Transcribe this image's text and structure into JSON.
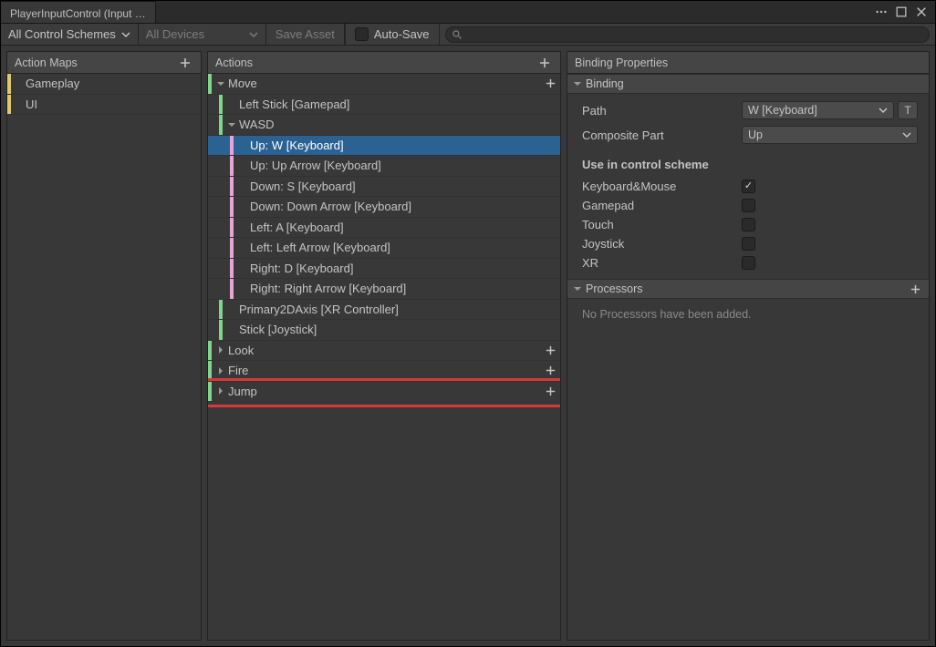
{
  "tab": {
    "title": "PlayerInputControl (Input …"
  },
  "toolbar": {
    "scheme_label": "All Control Schemes",
    "devices_label": "All Devices",
    "save_label": "Save Asset",
    "autosave_label": "Auto-Save",
    "autosave_checked": false
  },
  "columns": {
    "maps_title": "Action Maps",
    "actions_title": "Actions",
    "props_title": "Binding Properties"
  },
  "maps": [
    {
      "label": "Gameplay"
    },
    {
      "label": "UI"
    }
  ],
  "actions": [
    {
      "kind": "action",
      "label": "Move",
      "stripe": "green",
      "fold": "open",
      "indent": 0,
      "plus": true
    },
    {
      "kind": "binding",
      "label": "Left Stick [Gamepad]",
      "stripe": "green",
      "indent": 1
    },
    {
      "kind": "composite",
      "label": "WASD",
      "stripe": "green",
      "fold": "open",
      "indent": 1
    },
    {
      "kind": "part",
      "label": "Up: W [Keyboard]",
      "stripe": "pink",
      "indent": 2,
      "selected": true
    },
    {
      "kind": "part",
      "label": "Up: Up Arrow [Keyboard]",
      "stripe": "pink",
      "indent": 2
    },
    {
      "kind": "part",
      "label": "Down: S [Keyboard]",
      "stripe": "pink",
      "indent": 2
    },
    {
      "kind": "part",
      "label": "Down: Down Arrow [Keyboard]",
      "stripe": "pink",
      "indent": 2
    },
    {
      "kind": "part",
      "label": "Left: A [Keyboard]",
      "stripe": "pink",
      "indent": 2
    },
    {
      "kind": "part",
      "label": "Left: Left Arrow [Keyboard]",
      "stripe": "pink",
      "indent": 2
    },
    {
      "kind": "part",
      "label": "Right: D [Keyboard]",
      "stripe": "pink",
      "indent": 2
    },
    {
      "kind": "part",
      "label": "Right: Right Arrow [Keyboard]",
      "stripe": "pink",
      "indent": 2
    },
    {
      "kind": "binding",
      "label": "Primary2DAxis [XR Controller]",
      "stripe": "green",
      "indent": 1
    },
    {
      "kind": "binding",
      "label": "Stick [Joystick]",
      "stripe": "green",
      "indent": 1
    },
    {
      "kind": "action",
      "label": "Look",
      "stripe": "green",
      "fold": "closed",
      "indent": 0,
      "plus": true
    },
    {
      "kind": "action",
      "label": "Fire",
      "stripe": "green",
      "fold": "closed",
      "indent": 0,
      "plus": true
    },
    {
      "kind": "action",
      "label": "Jump",
      "stripe": "green",
      "fold": "closed",
      "indent": 0,
      "plus": true,
      "highlight": true
    }
  ],
  "binding": {
    "section_title": "Binding",
    "path_label": "Path",
    "path_value": "W [Keyboard]",
    "path_btn": "T",
    "composite_label": "Composite Part",
    "composite_value": "Up",
    "scheme_header": "Use in control scheme",
    "schemes": [
      {
        "label": "Keyboard&Mouse",
        "checked": true
      },
      {
        "label": "Gamepad",
        "checked": false
      },
      {
        "label": "Touch",
        "checked": false
      },
      {
        "label": "Joystick",
        "checked": false
      },
      {
        "label": "XR",
        "checked": false
      }
    ]
  },
  "processors": {
    "section_title": "Processors",
    "empty": "No Processors have been added."
  }
}
